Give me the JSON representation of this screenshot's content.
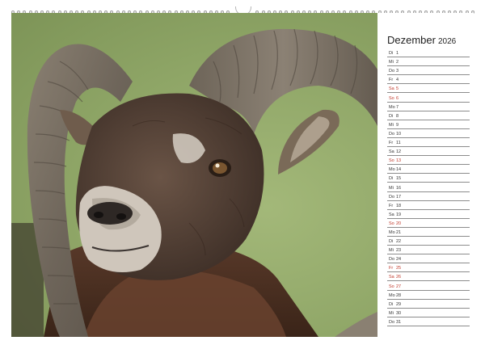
{
  "calendar": {
    "month": "Dezember",
    "year": "2026",
    "days": [
      {
        "wd": "Di",
        "d": "1",
        "holiday": false
      },
      {
        "wd": "Mi",
        "d": "2",
        "holiday": false
      },
      {
        "wd": "Do",
        "d": "3",
        "holiday": false
      },
      {
        "wd": "Fr",
        "d": "4",
        "holiday": false
      },
      {
        "wd": "Sa",
        "d": "5",
        "holiday": true
      },
      {
        "wd": "So",
        "d": "6",
        "holiday": true
      },
      {
        "wd": "Mo",
        "d": "7",
        "holiday": false
      },
      {
        "wd": "Di",
        "d": "8",
        "holiday": false
      },
      {
        "wd": "Mi",
        "d": "9",
        "holiday": false
      },
      {
        "wd": "Do",
        "d": "10",
        "holiday": false
      },
      {
        "wd": "Fr",
        "d": "11",
        "holiday": false
      },
      {
        "wd": "Sa",
        "d": "12",
        "holiday": false
      },
      {
        "wd": "So",
        "d": "13",
        "holiday": true
      },
      {
        "wd": "Mo",
        "d": "14",
        "holiday": false
      },
      {
        "wd": "Di",
        "d": "15",
        "holiday": false
      },
      {
        "wd": "Mi",
        "d": "16",
        "holiday": false
      },
      {
        "wd": "Do",
        "d": "17",
        "holiday": false
      },
      {
        "wd": "Fr",
        "d": "18",
        "holiday": false
      },
      {
        "wd": "Sa",
        "d": "19",
        "holiday": false
      },
      {
        "wd": "So",
        "d": "20",
        "holiday": true
      },
      {
        "wd": "Mo",
        "d": "21",
        "holiday": false
      },
      {
        "wd": "Di",
        "d": "22",
        "holiday": false
      },
      {
        "wd": "Mi",
        "d": "23",
        "holiday": false
      },
      {
        "wd": "Do",
        "d": "24",
        "holiday": false
      },
      {
        "wd": "Fr",
        "d": "25",
        "holiday": true
      },
      {
        "wd": "Sa",
        "d": "26",
        "holiday": true
      },
      {
        "wd": "So",
        "d": "27",
        "holiday": true
      },
      {
        "wd": "Mo",
        "d": "28",
        "holiday": false
      },
      {
        "wd": "Di",
        "d": "29",
        "holiday": false
      },
      {
        "wd": "Mi",
        "d": "30",
        "holiday": false
      },
      {
        "wd": "Do",
        "d": "31",
        "holiday": false
      }
    ]
  },
  "photo": {
    "subject": "mouflon-ram-photo"
  },
  "colors": {
    "holiday": "#c0392b",
    "text": "#333333",
    "rule": "#8c8c8c"
  }
}
